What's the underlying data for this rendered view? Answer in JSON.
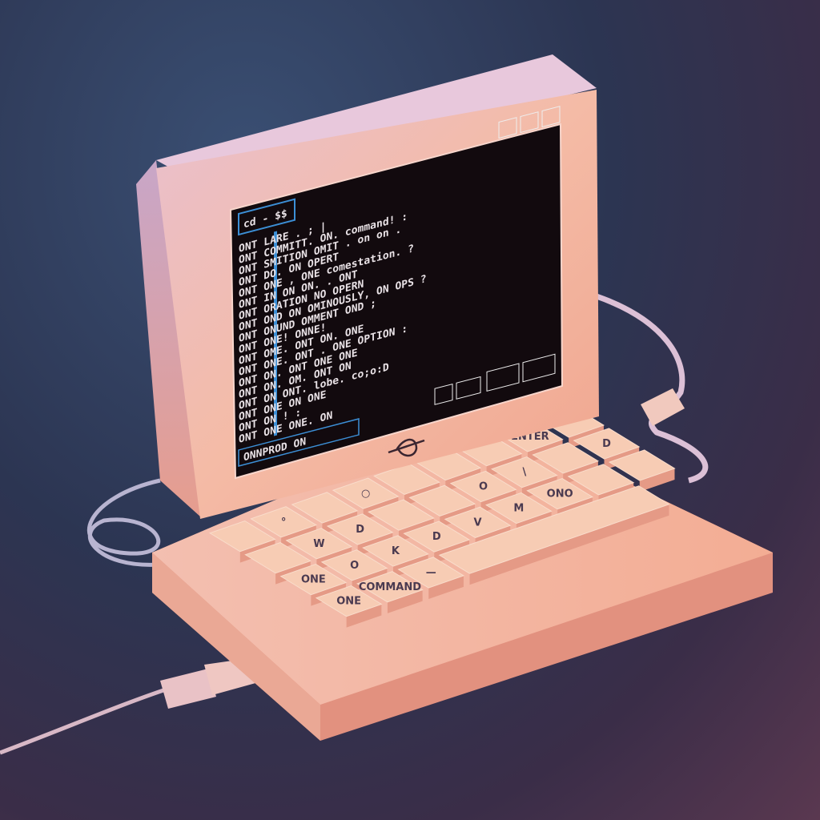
{
  "scene": "retro computer",
  "colors": {
    "shell": "#f2b8a4",
    "shell_shadow": "#c98b7e",
    "screen": "#120a0e",
    "screen_text": "#e9e2e6",
    "accent_blue": "#3c8fd6",
    "background": "#2f3956"
  },
  "screen": {
    "title": "cd - $$",
    "lines": [
      "ONT LARE . ; |",
      "ONT COMMITT. ON. command! :",
      "ONT SMITION OMIT . on on .",
      "ONT DO. ON OPERT",
      "ONT ONE , ONE comestation. ?",
      "ONT IN ON ON. . ONT",
      "ONT ORATION NO OPERN",
      "ONT OND ON OMINOUSLY, ON OPS ?",
      "ONT ONUND OMMENT OND ;",
      "ONT ONE! ONNE!",
      "ONT OME. ONT ON. ONE",
      "ONT ONE. ONT . ONE OPTION :",
      "ONT ON. ONT ONE ONE",
      "ONT ON. OM. ONT ON",
      "ONT ON ONT. lobe. co;o:D",
      "ONT ONE ON ONE",
      "ONT ON ! :",
      "ONT ONE ONE. ON"
    ],
    "status_line": "ONNPROD ON",
    "top_icons": [
      "window-icon",
      "box-icon",
      "arrow-icon"
    ],
    "bottom_icons": [
      "ds-icon",
      "ca-icon",
      "cloud-icon",
      "hand-icon"
    ]
  },
  "keyboard": {
    "keys": [
      [
        "",
        "°",
        "",
        "○",
        "",
        "",
        "",
        "ENTER",
        ""
      ],
      [
        "",
        "W",
        "D",
        "",
        "",
        "O",
        "\\",
        "",
        "D"
      ],
      [
        "ONE",
        "O",
        "K",
        "D",
        "V",
        "M",
        "ONO",
        "",
        ""
      ],
      [
        "ONE",
        "COMMAND",
        "—",
        "",
        "",
        "",
        "",
        "",
        ""
      ]
    ]
  }
}
